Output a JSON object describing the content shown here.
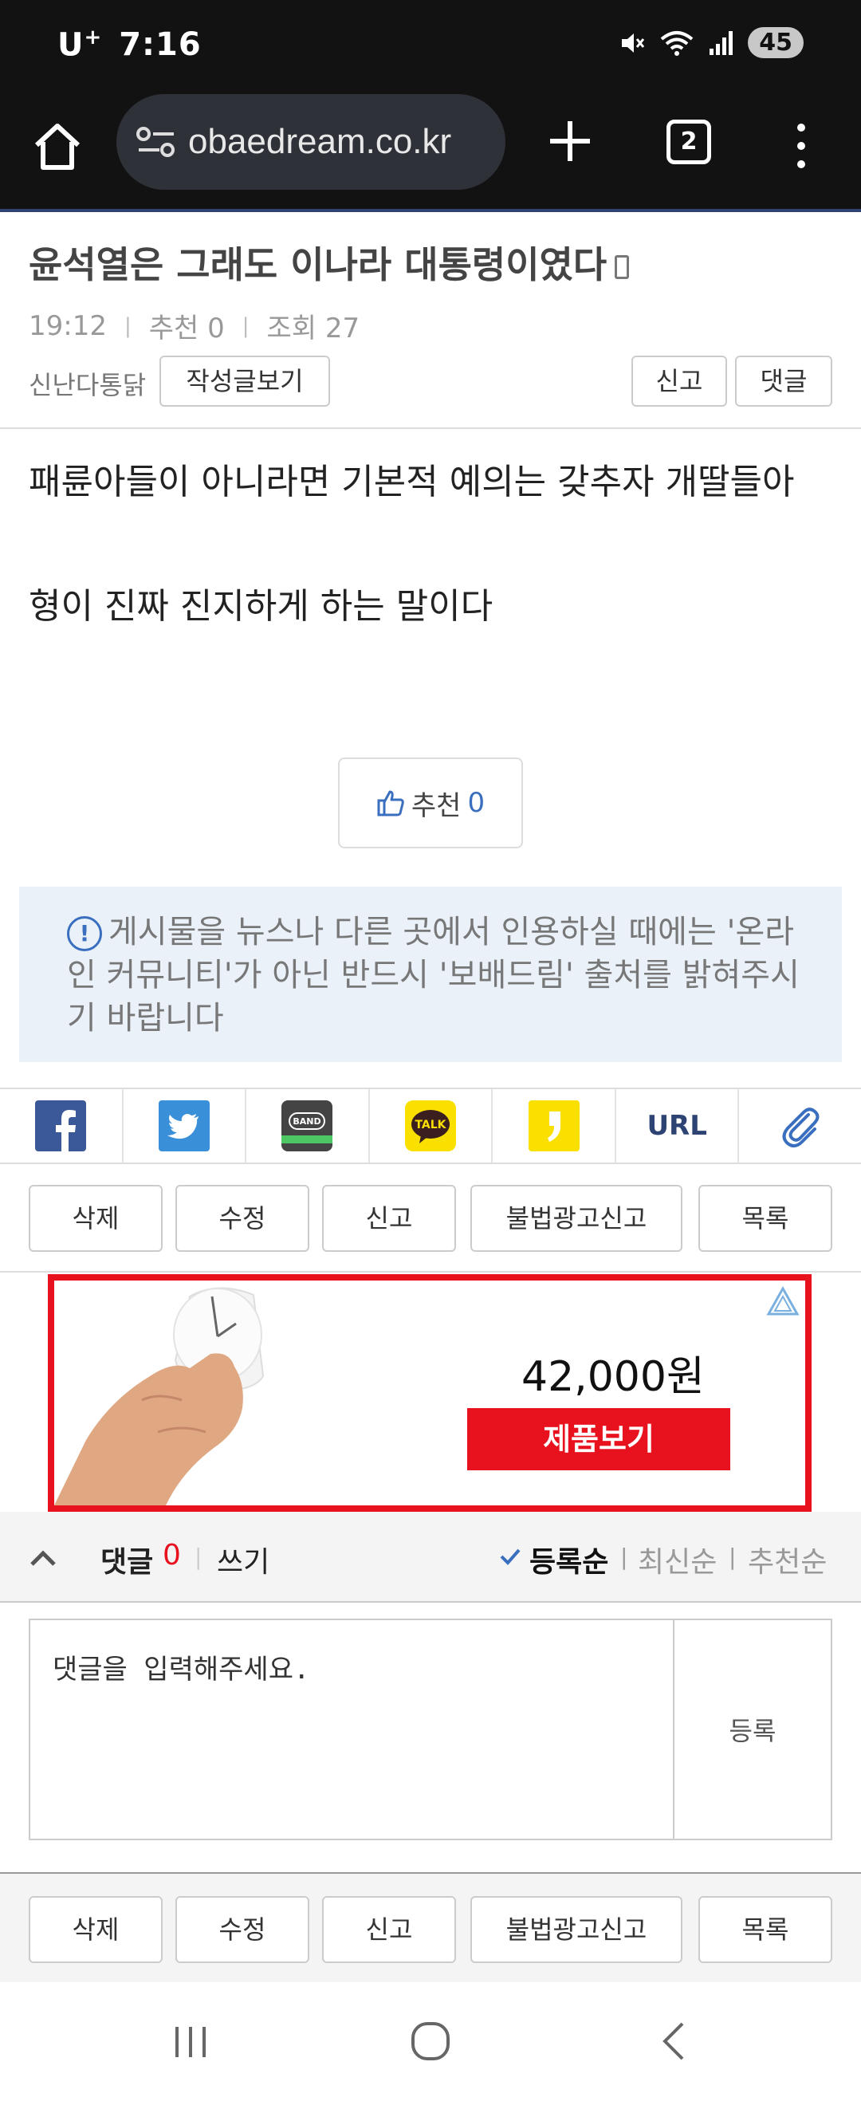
{
  "status_bar": {
    "carrier": "U",
    "carrier_sup": "+",
    "time": "7:16",
    "battery": "45"
  },
  "browser": {
    "url": "obaedream.co.kr",
    "tab_count": "2"
  },
  "post": {
    "title": "윤석열은 그래도 이나라 대통령이였다",
    "time": "19:12",
    "recommend": "추천 0",
    "views": "조회 27",
    "author": "신난다통닭",
    "view_posts_button": "작성글보기",
    "report_button": "신고",
    "comment_button": "댓글",
    "body_lines": [
      "패륜아들이 아니라면 기본적 예의는 갖추자 개딸들아",
      "",
      "형이 진짜 진지하게 하는 말이다"
    ],
    "recommend_label": "추천",
    "recommend_count": "0"
  },
  "notice": {
    "text": "게시물을 뉴스나 다른 곳에서 인용하실 때에는 '온라인 커뮤니티'가 아닌 반드시 '보배드림' 출처를 밝혀주시기 바랍니다"
  },
  "share": {
    "items": [
      "facebook",
      "twitter",
      "band",
      "kakaotalk",
      "kakaostory",
      "URL",
      "clip"
    ],
    "url_label": "URL",
    "band_label": "BAND",
    "talk_label": "TALK"
  },
  "actions": {
    "delete": "삭제",
    "edit": "수정",
    "report": "신고",
    "illegal_ad_report": "불법광고신고",
    "list": "목록"
  },
  "ad": {
    "price": "42,000원",
    "cta": "제품보기"
  },
  "comments": {
    "label": "댓글",
    "count": "0",
    "write": "쓰기",
    "sort_registered": "등록순",
    "sort_latest": "최신순",
    "sort_recommended": "추천순",
    "placeholder": "댓글을 입력해주세요.",
    "submit": "등록"
  },
  "colors": {
    "accent_red": "#e8121f",
    "link_blue": "#3a6fbf",
    "notice_bg": "#eaf1f9"
  }
}
